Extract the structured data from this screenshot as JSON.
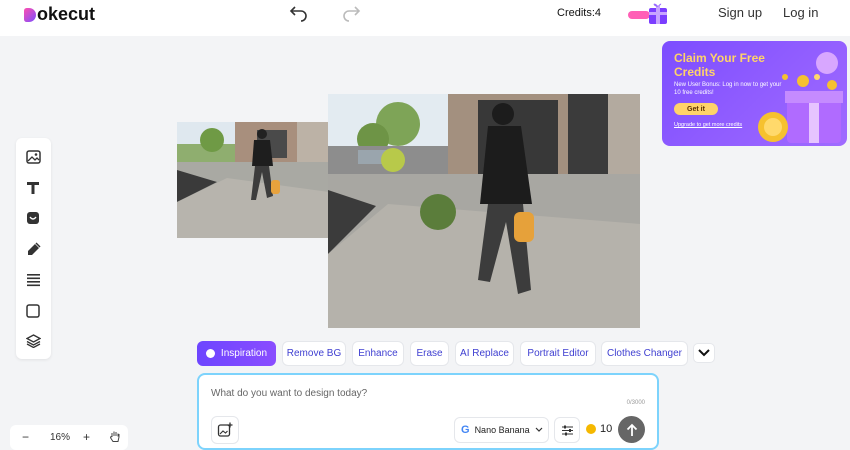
{
  "header": {
    "logo_text": "okecut",
    "credits_label": "Credits:4",
    "signup_label": "Sign up",
    "login_label": "Log in",
    "icons": [
      "undo-icon",
      "redo-icon",
      "gift-icon"
    ]
  },
  "toolbar": {
    "tools": [
      "image-icon",
      "text-icon",
      "sticker-icon",
      "brush-icon",
      "lines-icon",
      "shape-icon",
      "layers-icon"
    ]
  },
  "zoom": {
    "minus": "−",
    "level": "16%",
    "plus": "+",
    "hand_icon": "hand-icon"
  },
  "promo": {
    "title": "Claim Your Free Credits",
    "subtitle": "New User Bonus: Log in now to get your 10 free credits!",
    "button": "Get it",
    "link": "Upgrade to get more credits"
  },
  "chips": [
    {
      "label": "Inspiration",
      "active": true
    },
    {
      "label": "Remove BG",
      "active": false
    },
    {
      "label": "Enhance",
      "active": false
    },
    {
      "label": "Erase",
      "active": false
    },
    {
      "label": "AI Replace",
      "active": false
    },
    {
      "label": "Portrait Editor",
      "active": false
    },
    {
      "label": "Clothes Changer",
      "active": false
    }
  ],
  "prompt": {
    "placeholder": "What do you want to design today?",
    "counter": "0/3000",
    "model": "Nano Banana",
    "cost": "10"
  },
  "colors": {
    "accent": "#6d45ff",
    "promo_gold": "#ffd369",
    "prompt_border": "#7dd3fc"
  }
}
